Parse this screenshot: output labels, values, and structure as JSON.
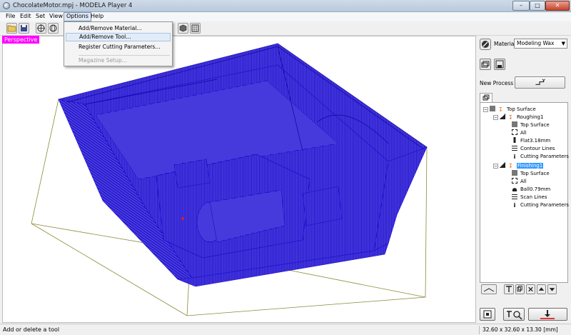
{
  "window": {
    "title": "ChocolateMotor.mpj - MODELA Player 4",
    "minimize": "–",
    "maximize": "□",
    "close": "✕"
  },
  "menubar": {
    "items": [
      "File",
      "Edit",
      "Set",
      "View",
      "Options",
      "Help"
    ],
    "open_menu": "Options"
  },
  "options_menu": {
    "items": [
      {
        "label": "Add/Remove Material...",
        "enabled": true
      },
      {
        "label": "Add/Remove Tool...",
        "enabled": true,
        "highlighted": true
      },
      {
        "label": "Register Cutting Parameters...",
        "enabled": true
      },
      {
        "label": "Magazine Setup...",
        "enabled": false
      }
    ]
  },
  "viewport": {
    "label": "Perspective",
    "toolpath_color": "#1a0ccc",
    "boundary_color": "#8a8a3a"
  },
  "material": {
    "label": "Material",
    "value": "Modeling Wax"
  },
  "new_process": {
    "label": "New Process"
  },
  "tree": {
    "root": "Top Surface",
    "roughing": {
      "name": "Roughing1",
      "items": [
        "Top Surface",
        "All",
        "Flat3.18mm",
        "Contour Lines",
        "Cutting Parameters"
      ]
    },
    "finishing": {
      "name": "Finishing1",
      "items": [
        "Top Surface",
        "All",
        "Ball0.79mm",
        "Scan Lines",
        "Cutting Parameters"
      ]
    }
  },
  "status": {
    "message": "Add or delete a tool",
    "dimensions": "32.60 x 32.60 x 13.30 [mm]"
  },
  "colors": {
    "selection": "#3399ff",
    "view_label_bg": "#ff00ff",
    "warning_orange": "#e86a10"
  }
}
